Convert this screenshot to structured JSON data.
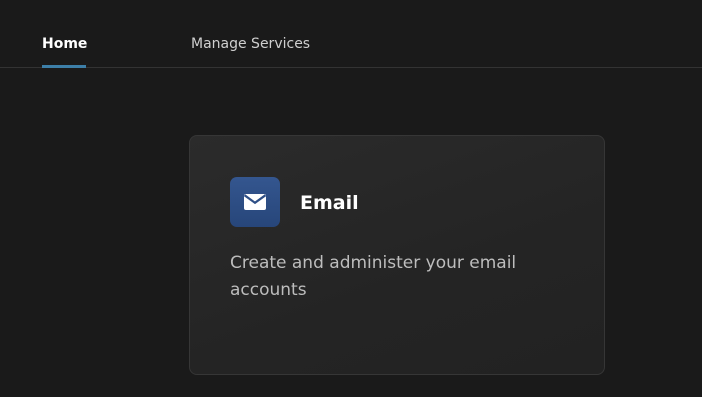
{
  "nav": {
    "tabs": [
      {
        "label": "Home",
        "active": true
      },
      {
        "label": "Manage Services",
        "active": false
      }
    ],
    "accent_color": "#3d7fa8"
  },
  "card": {
    "icon": "envelope-icon",
    "icon_background": "#2e4f86",
    "title": "Email",
    "description": "Create and administer your email accounts"
  }
}
